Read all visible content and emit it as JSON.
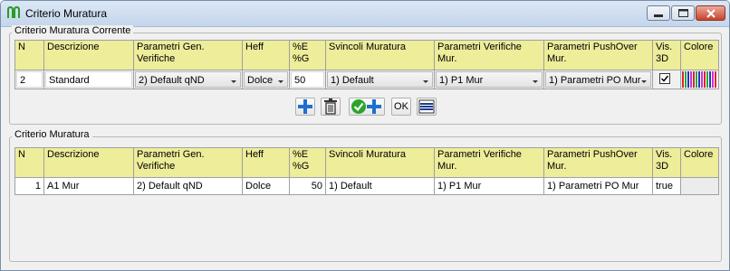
{
  "window": {
    "title": "Criterio Muratura",
    "icons": {
      "app": "masonry-icon",
      "minimize": "minimize-icon",
      "maximize": "maximize-icon",
      "close": "close-icon"
    }
  },
  "current_section": {
    "title": "Criterio Muratura Corrente",
    "columns": [
      "N",
      "Descrizione",
      "Parametri Gen. Verifiche",
      "Heff",
      "%E %G",
      "Svincoli Muratura",
      "Parametri Verifiche Mur.",
      "Parametri PushOver Mur.",
      "Vis. 3D",
      "Colore"
    ],
    "row": {
      "n": "2",
      "descrizione": "Standard",
      "parametri_gen": "2) Default qND",
      "heff": "Dolce",
      "perc": "50",
      "svincoli": "1) Default",
      "parametri_verifiche": "1) P1 Mur",
      "parametri_pushover": "1) Parametri PO Mur",
      "vis3d_checked": true
    }
  },
  "toolbar": {
    "add_icon": "plus-icon",
    "delete_icon": "trash-icon",
    "confirm_add_icon": "check-plus-icon",
    "ok_label": "OK",
    "list_icon": "lines-icon"
  },
  "list_section": {
    "title": "Criterio Muratura",
    "columns": [
      "N",
      "Descrizione",
      "Parametri Gen. Verifiche",
      "Heff",
      "%E %G",
      "Svincoli Muratura",
      "Parametri Verifiche Mur.",
      "Parametri PushOver Mur.",
      "Vis. 3D",
      "Colore"
    ],
    "rows": [
      {
        "n": "1",
        "descrizione": "A1 Mur",
        "parametri_gen": "2) Default qND",
        "heff": "Dolce",
        "perc": "50",
        "svincoli": "1) Default",
        "parametri_verifiche": "1) P1 Mur",
        "parametri_pushover": "1) Parametri PO Mur",
        "vis3d": "true",
        "colore": ""
      }
    ]
  },
  "colors": {
    "header": "#eded9a",
    "accent": "#1f6fd0",
    "confirm": "#2aa52a"
  }
}
